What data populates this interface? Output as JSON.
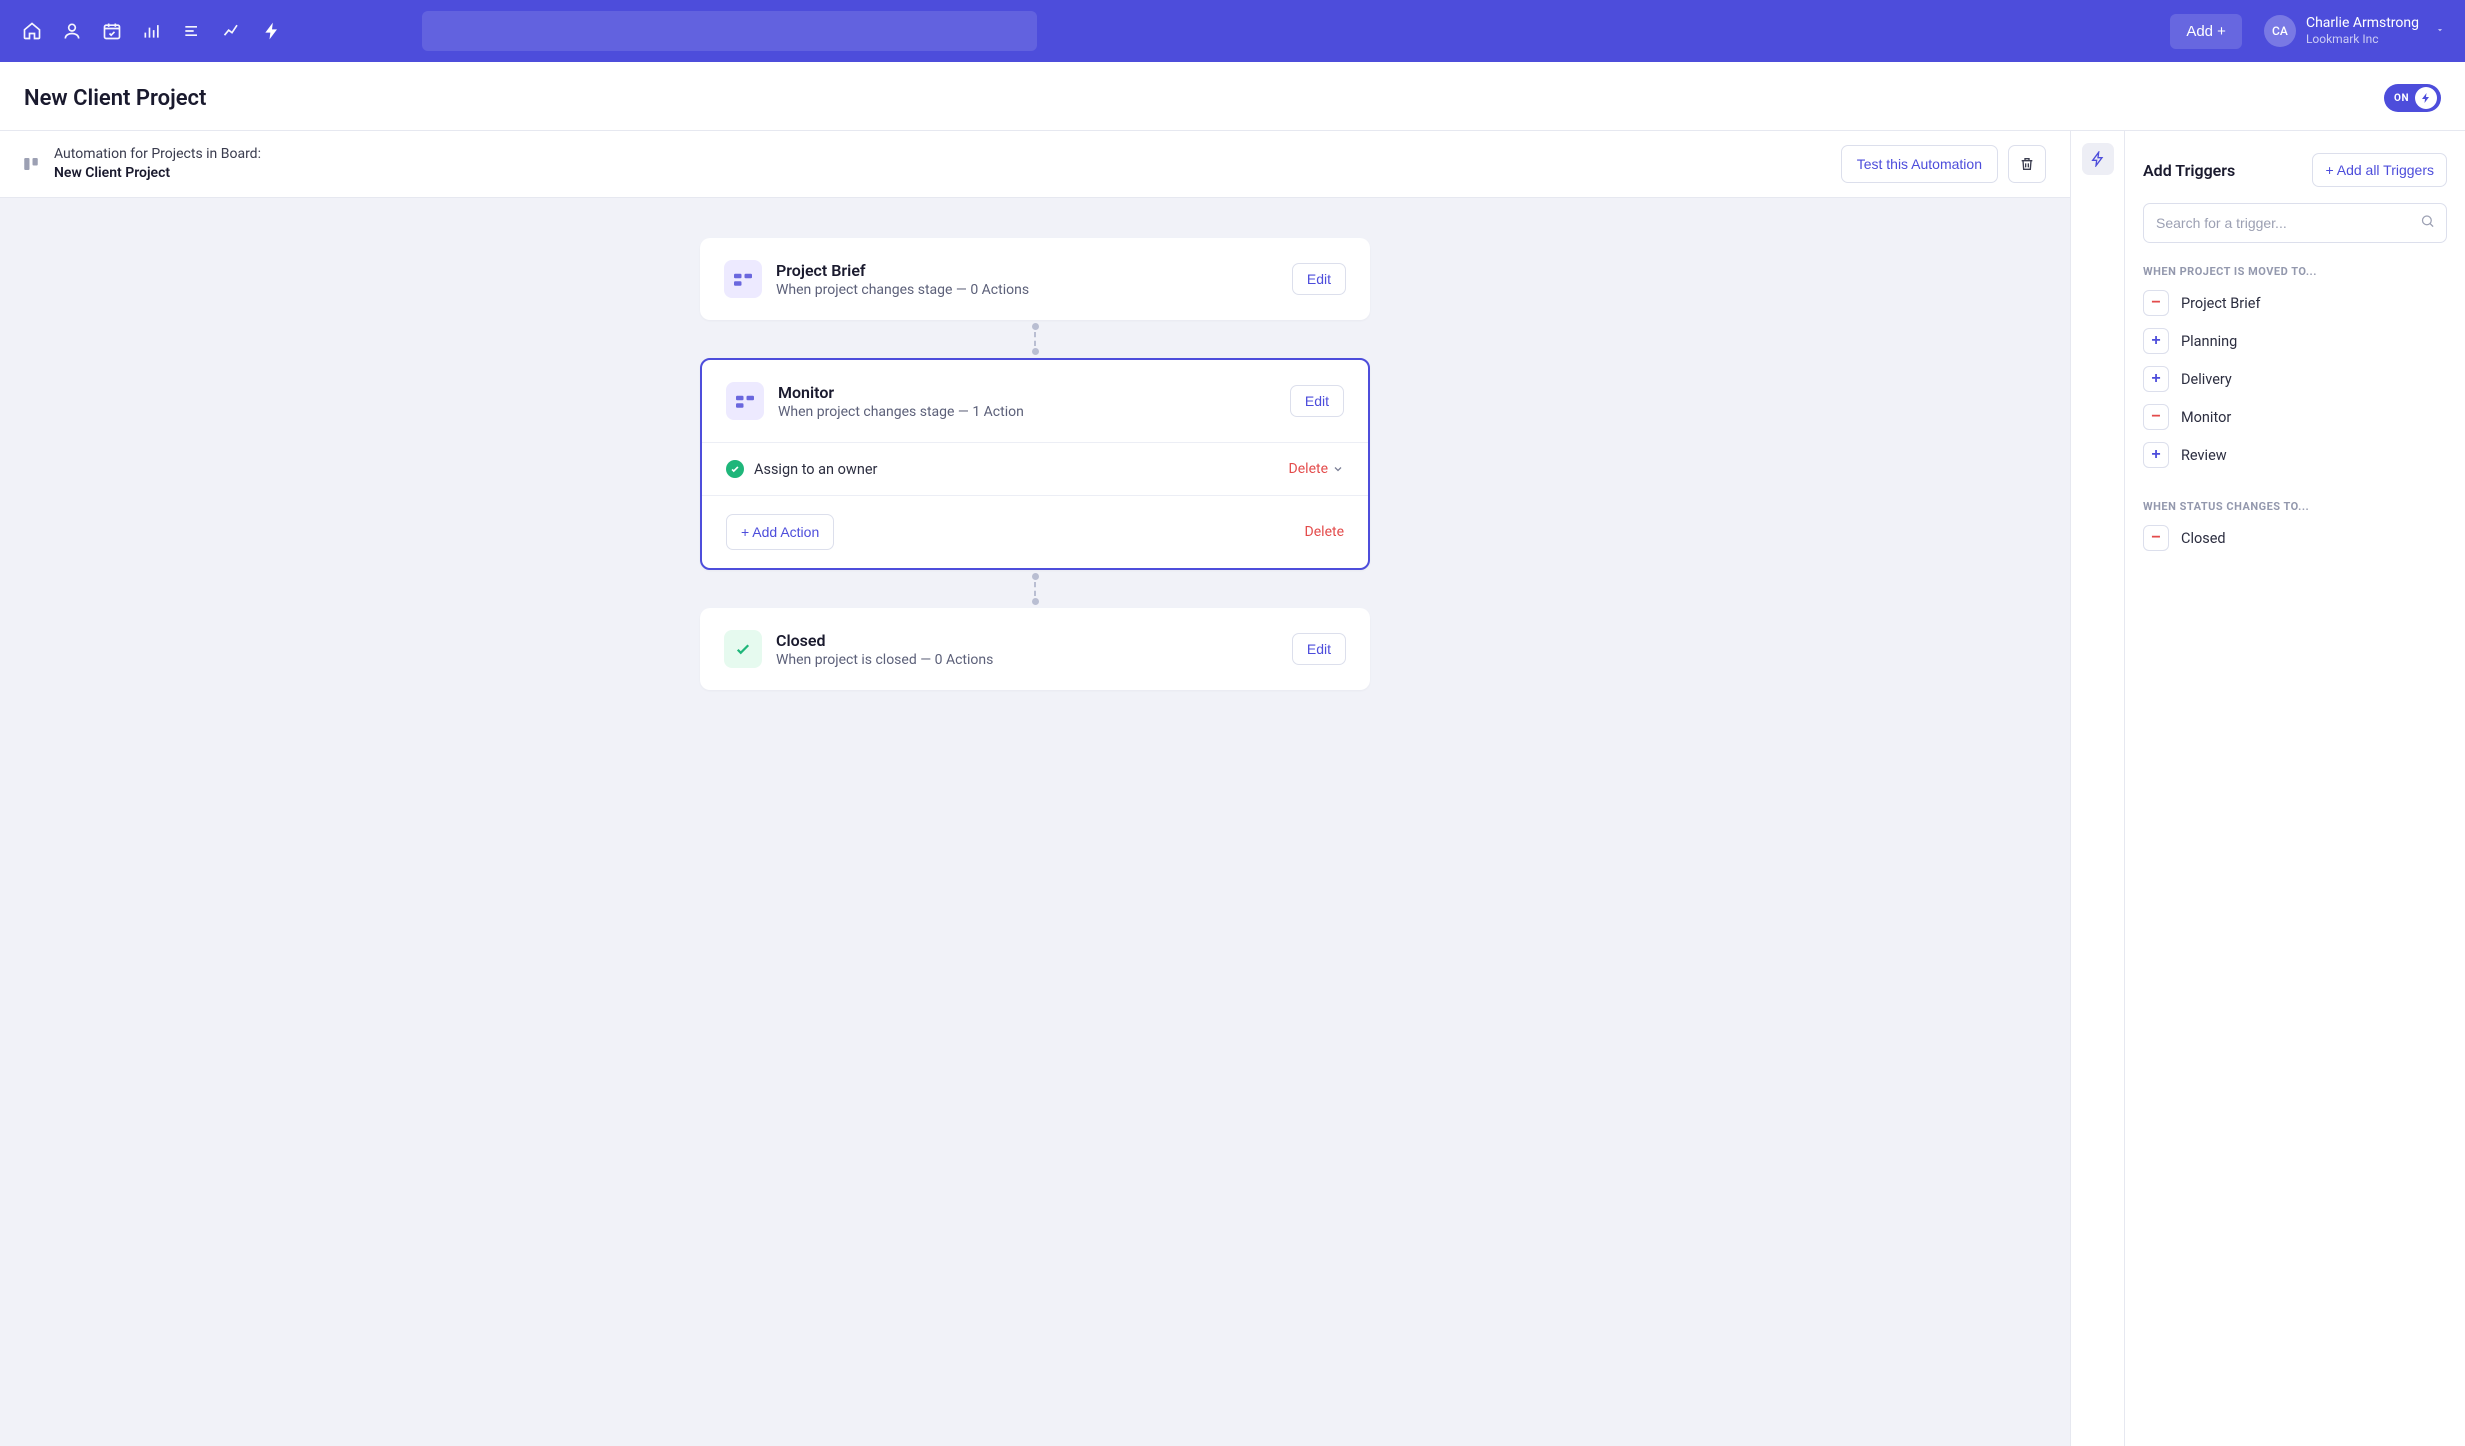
{
  "nav": {
    "add_label": "Add +"
  },
  "user": {
    "initials": "CA",
    "name": "Charlie Armstrong",
    "org": "Lookmark Inc"
  },
  "page": {
    "title": "New Client Project",
    "toggle_label": "ON"
  },
  "subheader": {
    "label": "Automation for Projects in Board:",
    "board_name": "New Client Project",
    "test_btn": "Test this Automation"
  },
  "cards": {
    "brief": {
      "title": "Project Brief",
      "sub": "When project changes stage — 0 Actions",
      "edit": "Edit"
    },
    "monitor": {
      "title": "Monitor",
      "sub": "When project changes stage — 1 Action",
      "edit": "Edit",
      "action1": "Assign to an owner",
      "delete_action": "Delete",
      "add_action": "+ Add Action",
      "delete_trigger": "Delete"
    },
    "closed": {
      "title": "Closed",
      "sub": "When project is closed — 0 Actions",
      "edit": "Edit"
    }
  },
  "right": {
    "title": "Add Triggers",
    "add_all": "+  Add all Triggers",
    "search_placeholder": "Search for a trigger...",
    "group1_label": "When project is moved to...",
    "group2_label": "When Status changes to...",
    "items": {
      "projectBrief": "Project Brief",
      "planning": "Planning",
      "delivery": "Delivery",
      "monitor": "Monitor",
      "review": "Review",
      "closed": "Closed"
    }
  }
}
